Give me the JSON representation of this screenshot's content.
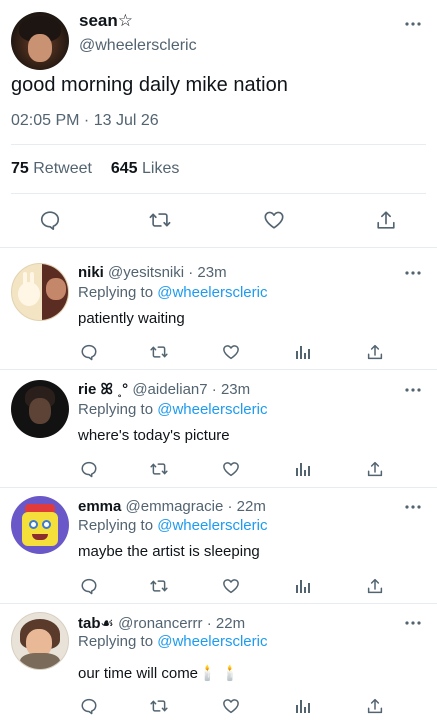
{
  "main_tweet": {
    "display_name": "sean☆",
    "handle": "@wheelerscleric",
    "text": "good morning daily mike nation",
    "time": "02:05 PM · 13 Jul 26",
    "retweet_count": "75",
    "retweet_label": "Retweet",
    "like_count": "645",
    "like_label": "Likes"
  },
  "replies": [
    {
      "display_name": "niki",
      "handle": "@yesitsniki",
      "time": "· 23m",
      "replying_prefix": "Replying to",
      "replying_to": "@wheelerscleric",
      "text": "patiently waiting"
    },
    {
      "display_name": "rie ꕤ ˳°",
      "handle": "@aidelian7",
      "time": "· 23m",
      "replying_prefix": "Replying to",
      "replying_to": "@wheelerscleric",
      "text": "where's today's picture"
    },
    {
      "display_name": "emma",
      "handle": "@emmagracie",
      "time": "· 22m",
      "replying_prefix": "Replying to",
      "replying_to": "@wheelerscleric",
      "text": "maybe the artist is sleeping"
    },
    {
      "display_name": "tab☙",
      "handle": "@ronancerrr",
      "time": "· 22m",
      "replying_prefix": "Replying to",
      "replying_to": "@wheelerscleric",
      "text": "our time will come🕯️ 🕯️"
    }
  ],
  "colors": {
    "text": "#0f1419",
    "secondary": "#536471",
    "link": "#1d9bf0",
    "divider": "#e6ecf0"
  },
  "icons": [
    "more-icon",
    "reply-icon",
    "retweet-icon",
    "like-icon",
    "share-icon",
    "analytics-icon"
  ]
}
